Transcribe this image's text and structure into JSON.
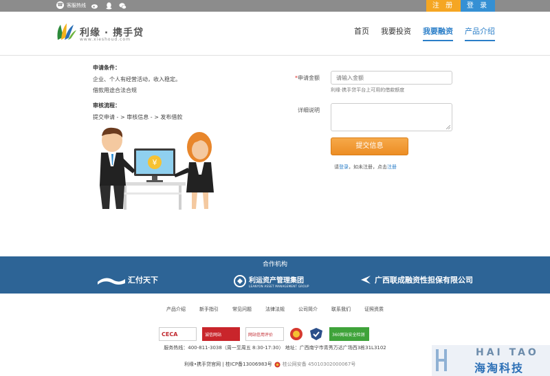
{
  "topbar": {
    "hotline_label": "客服热线",
    "register_label": "注 册",
    "login_label": "登 录"
  },
  "header": {
    "logo_name": "利缘 · 携手贷",
    "logo_url": "www.xieshoud.com",
    "nav": [
      "首页",
      "我要投资",
      "我要融资",
      "产品介绍"
    ],
    "active_nav": "我要融资"
  },
  "left": {
    "conditions_title": "申请条件：",
    "conditions_line1": "企业、个人有经营活动，收入稳定。",
    "conditions_line2": "借款用途合法合规",
    "process_title": "审核流程：",
    "process_text": "提交申请 - > 审核信息 - > 发布借款"
  },
  "form": {
    "amount_star": "*",
    "amount_label": "申请金额",
    "amount_placeholder": "请输入金额",
    "amount_hint": "利缘·携手贷平台上可用的借款额度",
    "detail_label": "详细说明",
    "submit_label": "提交信息",
    "login_hint_prefix": "请",
    "login_link": "登录",
    "login_hint_mid": "，如未注册，点击",
    "register_link": "注册"
  },
  "partners": {
    "title": "合作机构",
    "p1": "汇付天下",
    "p2": "利运资产管理集团",
    "p2_sub": "LEANYON ASSET MANAGEMENT GROUP",
    "p3": "广西联成融资性担保有限公司"
  },
  "footer": {
    "links": [
      "产品介绍",
      "新手指引",
      "常见问题",
      "法律法规",
      "公司简介",
      "联系我们",
      "证照资质"
    ],
    "badges": [
      "CECA",
      "诚信网站",
      "网站信用评价",
      "",
      "",
      "360网站安全检测"
    ],
    "service": "服务热线：400-811-3038（周一至周五 8:30-17:30） 地址：广西南宁市青秀万达广场西3栋31L3102",
    "copyright": "利缘•携手贷官网 | 桂ICP备13006983号",
    "police": "桂公网安备 45010302000067号"
  },
  "watermark": {
    "en": "HAI TAO",
    "cn": "海淘科技"
  }
}
